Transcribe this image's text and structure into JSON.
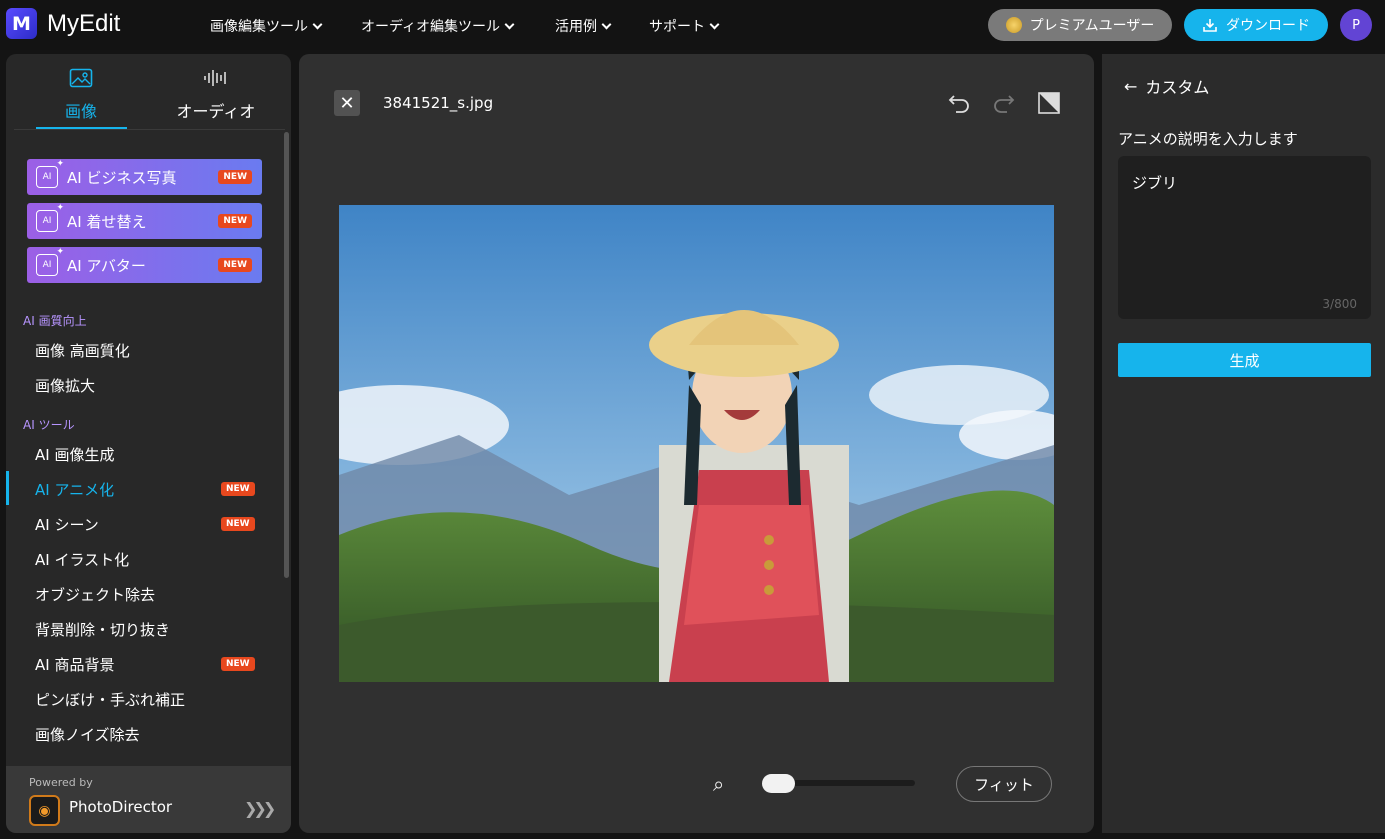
{
  "app": {
    "logo_text": "MyEdit",
    "logo_mark": "M"
  },
  "nav": {
    "items": [
      {
        "label": "画像編集ツール"
      },
      {
        "label": "オーディオ編集ツール"
      },
      {
        "label": "活用例"
      },
      {
        "label": "サポート"
      }
    ],
    "premium_label": "プレミアムユーザー",
    "download_label": "ダウンロード",
    "avatar_letter": "P"
  },
  "sidebar": {
    "tabs": [
      {
        "label": "画像",
        "active": true
      },
      {
        "label": "オーディオ",
        "active": false
      }
    ],
    "featured": [
      {
        "label": "AI ビジネス写真",
        "badge": "NEW"
      },
      {
        "label": "AI 着せ替え",
        "badge": "NEW"
      },
      {
        "label": "AI アバター",
        "badge": "NEW"
      }
    ],
    "section1": {
      "title": "AI 画質向上",
      "items": [
        "画像 高画質化",
        "画像拡大"
      ]
    },
    "section2": {
      "title": "AI ツール",
      "items": [
        {
          "label": "AI 画像生成",
          "badge": ""
        },
        {
          "label": "AI アニメ化",
          "badge": "NEW",
          "active": true
        },
        {
          "label": "AI シーン",
          "badge": "NEW"
        },
        {
          "label": "AI イラスト化",
          "badge": ""
        },
        {
          "label": "オブジェクト除去",
          "badge": ""
        },
        {
          "label": "背景削除・切り抜き",
          "badge": ""
        },
        {
          "label": "AI 商品背景",
          "badge": "NEW"
        },
        {
          "label": "ピンぼけ・手ぶれ補正",
          "badge": ""
        },
        {
          "label": "画像ノイズ除去",
          "badge": ""
        }
      ]
    },
    "powered_by": "Powered by",
    "powered_product": "PhotoDirector"
  },
  "editor": {
    "filename": "3841521_s.jpg",
    "zoom_level": 0.05,
    "fit_label": "フィット"
  },
  "panel": {
    "back_label": "カスタム",
    "prompt_label": "アニメの説明を入力します",
    "prompt_value": "ジブリ",
    "counter": "3/800",
    "generate_label": "生成"
  },
  "colors": {
    "accent": "#16b4ec",
    "badge": "#e8481e",
    "section_head": "#b795ff"
  }
}
